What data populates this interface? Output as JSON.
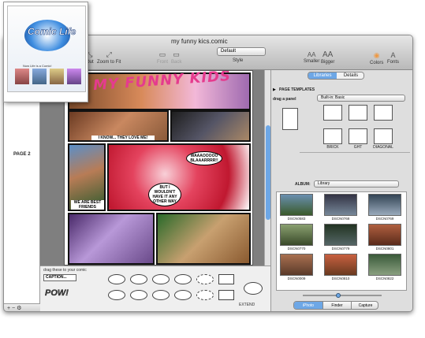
{
  "window": {
    "title": "my funny kics.comic",
    "toolbar": {
      "zoom_out": "Out",
      "zoom_to_fit": "Zoom to Fit",
      "front": "Front",
      "back": "Back",
      "style_value": "Default",
      "style_label": "Style",
      "smaller": "Smaller",
      "bigger": "Bigger",
      "colors": "Colors",
      "fonts": "Fonts",
      "aa": "AA"
    }
  },
  "pages": {
    "page2_label": "PAGE 2",
    "bar_buttons": "+  −  ⚙"
  },
  "comic": {
    "title": "MY FUNNY KIDS",
    "captions": [
      "I KNOW... THEY LOVE ME!",
      "WAAAOOOOO BLAAARRRR!!",
      "WE ARE BEST FRIENDS",
      "BUT I WOULDN'T HAVE IT ANY OTHER WAY"
    ]
  },
  "tray": {
    "label": "drag these to your comic",
    "caption": "CAPTION...",
    "pow": "POW!",
    "extend": "EXTEND"
  },
  "library": {
    "tab_libraries": "Libraries",
    "tab_details": "Details",
    "page_templates_label": "PAGE TEMPLATES",
    "builtin_value": "Built-in: Basic",
    "drag_panel": "drag a panel",
    "templates": [
      "BRICK",
      "GHT",
      "DIAGONAL"
    ],
    "album_label": "ALBUM:",
    "album_value": "Library",
    "thumbs": [
      "DSCN0583",
      "DSCN0768",
      "DSCN0769",
      "DSCN0770",
      "DSCN0779",
      "DSCN0801",
      "DSCN0009",
      "DSCN0810",
      "DSCN0822"
    ],
    "sources": [
      "iPhoto",
      "Finder",
      "Capture"
    ]
  },
  "boxart": {
    "logo": "Comic Life",
    "tagline": "Now Life is a Comic!"
  },
  "colors": {
    "accent": "#e53b8e",
    "selected_tab": "#6da7e6"
  }
}
